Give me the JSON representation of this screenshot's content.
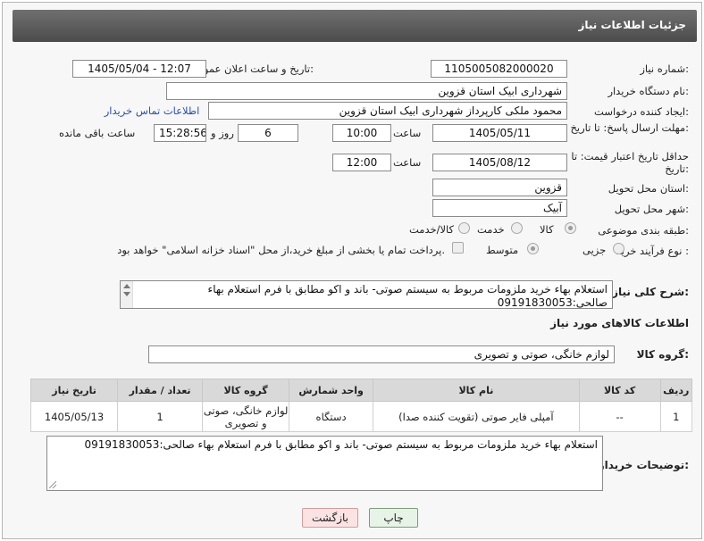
{
  "header": {
    "title": "جزئیات اطلاعات نیاز"
  },
  "fields": {
    "need_number": {
      "label": "شماره نیاز:",
      "value": "1105005082000020"
    },
    "announce_datetime": {
      "label": "تاریخ و ساعت اعلان عمومی:",
      "value": "1405/05/04 - 12:07"
    },
    "buyer_org": {
      "label": "نام دستگاه خریدار:",
      "value": "شهرداری ابیک استان قزوین"
    },
    "requester": {
      "label": "ایجاد کننده درخواست:",
      "value": "محمود ملکی کارپرداز شهرداری ابیک استان قزوین",
      "contact_link": "اطلاعات تماس خریدار"
    },
    "deadline": {
      "label": "مهلت ارسال پاسخ: تا تاریخ:",
      "date": "1405/05/11",
      "time_label": "ساعت",
      "time": "10:00",
      "days": "6",
      "days_label": "روز و",
      "remaining": "15:28:56",
      "remaining_label": "ساعت باقی مانده"
    },
    "price_validity": {
      "label": "حداقل تاریخ اعتبار قیمت: تا تاریخ:",
      "date": "1405/08/12",
      "time_label": "ساعت",
      "time": "12:00"
    },
    "province": {
      "label": "استان محل تحویل:",
      "value": "قزوین"
    },
    "city": {
      "label": "شهر محل تحویل:",
      "value": "آبیک"
    },
    "category": {
      "label": "طبقه بندی موضوعی:",
      "options": [
        "کالا",
        "خدمت",
        "کالا/خدمت"
      ],
      "selected": "کالا"
    },
    "process": {
      "label": "نوع فرآیند خرید :",
      "options": [
        "جزیی",
        "متوسط"
      ],
      "selected": "متوسط",
      "payment_note": "پرداخت تمام یا بخشی از مبلغ خرید،از محل \"اسناد خزانه اسلامی\" خواهد بود."
    }
  },
  "description": {
    "label": "شرح کلی نیاز:",
    "value": "استعلام بهاء خرید ملزومات مربوط به سیستم صوتی- باند و اکو مطابق با فرم استعلام بهاء صالحی:09191830053"
  },
  "goods_section": {
    "title": "اطلاعات کالاهای مورد نیاز",
    "group_label": "گروه کالا:",
    "group_value": "لوازم خانگی، صوتی و تصویری"
  },
  "table": {
    "headers": [
      "ردیف",
      "کد کالا",
      "نام کالا",
      "واحد شمارش",
      "گروه کالا",
      "تعداد / مقدار",
      "تاریخ نیاز"
    ],
    "rows": [
      [
        "1",
        "--",
        "آمپلی فایر صوتی (تقویت کننده صدا)",
        "دستگاه",
        "لوازم خانگی، صوتی و تصویری",
        "1",
        "1405/05/13"
      ]
    ]
  },
  "buyer_notes": {
    "label": "توضیحات خریدار:",
    "value": "استعلام بهاء خرید ملزومات مربوط به سیستم صوتی- باند و اکو مطابق با فرم استعلام بهاء صالحی:09191830053"
  },
  "buttons": {
    "print": "چاپ",
    "back": "بازگشت"
  }
}
